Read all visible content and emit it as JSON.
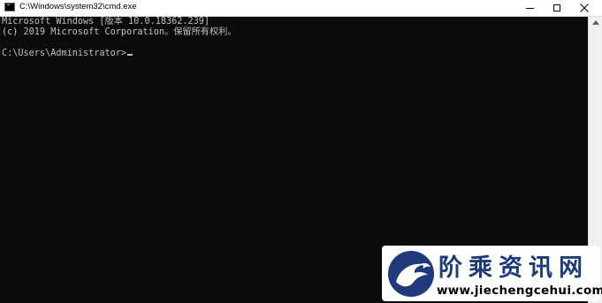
{
  "window": {
    "title": "C:\\Windows\\system32\\cmd.exe",
    "icon": "cmd-icon",
    "controls": [
      "minimize",
      "maximize",
      "close"
    ]
  },
  "console": {
    "lines": [
      "Microsoft Windows [版本 10.0.18362.239]",
      "(c) 2019 Microsoft Corporation。保留所有权利。",
      "C:\\Users\\Administrator>"
    ],
    "text_color": "#c0c0c0",
    "background": "#0c0c0c"
  },
  "watermark": {
    "title": "阶乘资讯网",
    "url": "www.jiechengcehui.com",
    "brand_color": "#1f3a7a"
  }
}
